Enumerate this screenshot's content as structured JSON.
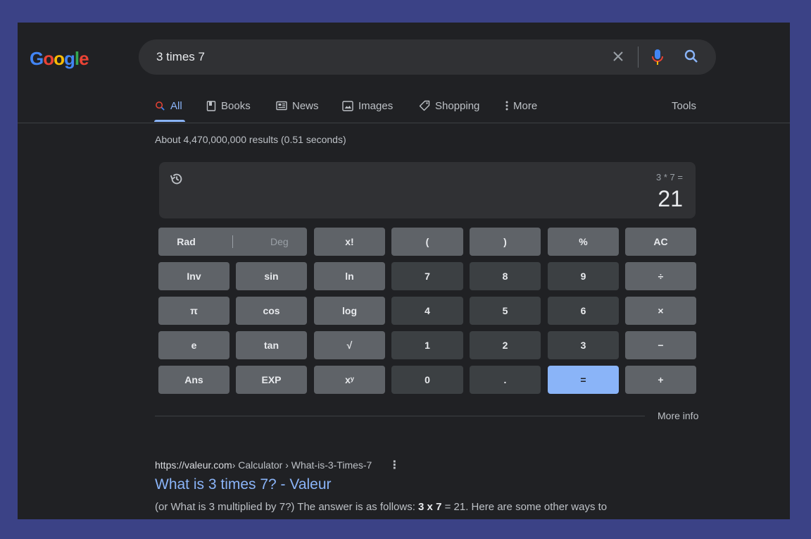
{
  "logo": {
    "letters": [
      {
        "ch": "G",
        "color": "#4285f4"
      },
      {
        "ch": "o",
        "color": "#ea4335"
      },
      {
        "ch": "o",
        "color": "#fbbc05"
      },
      {
        "ch": "g",
        "color": "#4285f4"
      },
      {
        "ch": "l",
        "color": "#34a853"
      },
      {
        "ch": "e",
        "color": "#ea4335"
      }
    ],
    "text": "Google"
  },
  "search": {
    "query": "3 times 7",
    "icons": [
      "close-icon",
      "mic-icon",
      "search-icon"
    ]
  },
  "tabs": [
    {
      "label": "All",
      "icon": "search-icon",
      "active": true
    },
    {
      "label": "Books",
      "icon": "book-icon"
    },
    {
      "label": "News",
      "icon": "news-icon"
    },
    {
      "label": "Images",
      "icon": "image-icon"
    },
    {
      "label": "Shopping",
      "icon": "tag-icon"
    },
    {
      "label": "More",
      "icon": "more-vert-icon"
    }
  ],
  "tools_label": "Tools",
  "stats": "About 4,470,000,000 results (0.51 seconds)",
  "calculator": {
    "expression": "3 * 7 =",
    "result": "21",
    "rad_label": "Rad",
    "deg_label": "Deg",
    "keys": {
      "fact": "x!",
      "lparen": "(",
      "rparen": ")",
      "percent": "%",
      "ac": "AC",
      "inv": "Inv",
      "sin": "sin",
      "ln": "ln",
      "k7": "7",
      "k8": "8",
      "k9": "9",
      "div": "÷",
      "pi": "π",
      "cos": "cos",
      "log": "log",
      "k4": "4",
      "k5": "5",
      "k6": "6",
      "mul": "×",
      "e": "e",
      "tan": "tan",
      "sqrt": "√",
      "k1": "1",
      "k2": "2",
      "k3": "3",
      "minus": "−",
      "ans": "Ans",
      "exp": "EXP",
      "pow": "xʸ",
      "k0": "0",
      "dot": ".",
      "eq": "=",
      "plus": "+"
    },
    "more_info": "More info"
  },
  "result": {
    "host": "https://valeur.com",
    "path": " › Calculator › What-is-3-Times-7",
    "title": "What is 3 times 7? - Valeur",
    "snippet_pre": "(or What is 3 multiplied by 7?) The answer is as follows: ",
    "snippet_bold": "3 x 7",
    "snippet_post": " = 21. Here are some other ways to"
  },
  "colors": {
    "accent": "#8ab4f8",
    "background": "#202124",
    "page_border": "#3b4286"
  }
}
